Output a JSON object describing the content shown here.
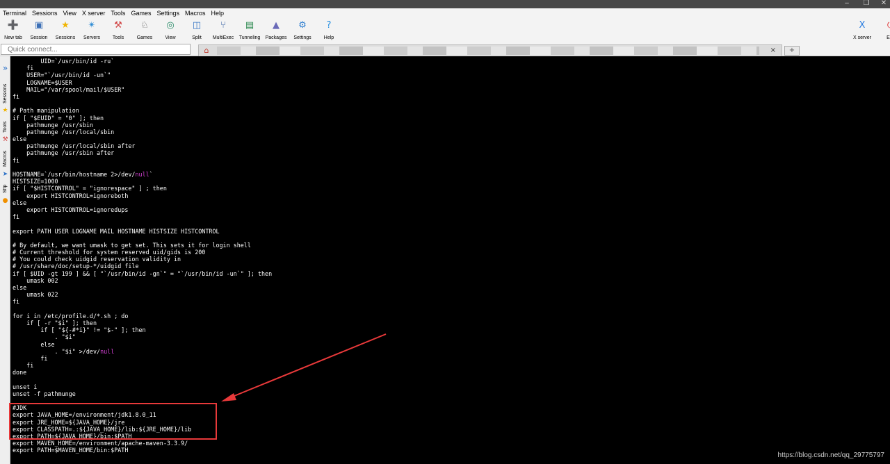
{
  "menu": [
    "Terminal",
    "Sessions",
    "View",
    "X server",
    "Tools",
    "Games",
    "Settings",
    "Macros",
    "Help"
  ],
  "toolbar": [
    {
      "label": "New tab",
      "icon": "new-tab-icon",
      "glyph": "➕",
      "color": "#2eab3a"
    },
    {
      "label": "Session",
      "icon": "session-icon",
      "glyph": "▣",
      "color": "#3b6fb6"
    },
    {
      "label": "Sessions",
      "icon": "sessions-star-icon",
      "glyph": "★",
      "color": "#f0b400"
    },
    {
      "label": "Servers",
      "icon": "servers-icon",
      "glyph": "✴",
      "color": "#2a8ad4"
    },
    {
      "label": "Tools",
      "icon": "tools-icon",
      "glyph": "⚒",
      "color": "#d04040"
    },
    {
      "label": "Games",
      "icon": "games-icon",
      "glyph": "♘",
      "color": "#555555"
    },
    {
      "label": "View",
      "icon": "view-icon",
      "glyph": "◎",
      "color": "#2c8c6a"
    },
    {
      "label": "Split",
      "icon": "split-icon",
      "glyph": "◫",
      "color": "#3574c4"
    },
    {
      "label": "MultiExec",
      "icon": "multiexec-icon",
      "glyph": "⑂",
      "color": "#2c5aa0"
    },
    {
      "label": "Tunneling",
      "icon": "tunneling-icon",
      "glyph": "▤",
      "color": "#2d8a50"
    },
    {
      "label": "Packages",
      "icon": "packages-icon",
      "glyph": "▲",
      "color": "#6a6ab8"
    },
    {
      "label": "Settings",
      "icon": "settings-gear-icon",
      "glyph": "⚙",
      "color": "#2f7fd0"
    },
    {
      "label": "Help",
      "icon": "help-icon",
      "glyph": "?",
      "color": "#1f8ce0"
    }
  ],
  "toolbar_right": [
    {
      "label": "X server",
      "icon": "x-server-icon",
      "glyph": "X",
      "color": "#2a7de0"
    },
    {
      "label": "Exit",
      "icon": "exit-power-icon",
      "glyph": "⏻",
      "color": "#e03030"
    }
  ],
  "quick_connect_placeholder": "Quick connect...",
  "sidebar": {
    "sessions": "Sessions",
    "tools": "Tools",
    "macros": "Macros",
    "sftp": "Sftp"
  },
  "terminal_lines": [
    "        UID=`/usr/bin/id -ru`",
    "    fi",
    "    USER=\"`/usr/bin/id -un`\"",
    "    LOGNAME=$USER",
    "    MAIL=\"/var/spool/mail/$USER\"",
    "fi",
    "",
    "# Path manipulation",
    "if [ \"$EUID\" = \"0\" ]; then",
    "    pathmunge /usr/sbin",
    "    pathmunge /usr/local/sbin",
    "else",
    "    pathmunge /usr/local/sbin after",
    "    pathmunge /usr/sbin after",
    "fi",
    "",
    "HOSTNAME=`/usr/bin/hostname 2>/dev/null`",
    "HISTSIZE=1000",
    "if [ \"$HISTCONTROL\" = \"ignorespace\" ] ; then",
    "    export HISTCONTROL=ignoreboth",
    "else",
    "    export HISTCONTROL=ignoredups",
    "fi",
    "",
    "export PATH USER LOGNAME MAIL HOSTNAME HISTSIZE HISTCONTROL",
    "",
    "# By default, we want umask to get set. This sets it for login shell",
    "# Current threshold for system reserved uid/gids is 200",
    "# You could check uidgid reservation validity in",
    "# /usr/share/doc/setup-*/uidgid file",
    "if [ $UID -gt 199 ] && [ \"`/usr/bin/id -gn`\" = \"`/usr/bin/id -un`\" ]; then",
    "    umask 002",
    "else",
    "    umask 022",
    "fi",
    "",
    "for i in /etc/profile.d/*.sh ; do",
    "    if [ -r \"$i\" ]; then",
    "        if [ \"${-#*i}\" != \"$-\" ]; then",
    "            . \"$i\"",
    "        else",
    "            . \"$i\" >/dev/null",
    "        fi",
    "    fi",
    "done",
    "",
    "unset i",
    "unset -f pathmunge",
    "",
    "#JDK",
    "export JAVA_HOME=/environment/jdk1.8.0_11",
    "export JRE_HOME=${JAVA_HOME}/jre",
    "export CLASSPATH=.:${JAVA_HOME}/lib:${JRE_HOME}/lib",
    "export PATH=${JAVA_HOME}/bin:$PATH",
    "export MAVEN_HOME=/environment/apache-maven-3.3.9/",
    "export PATH=$MAVEN_HOME/bin:$PATH"
  ],
  "watermark": "https://blog.csdn.net/qq_29775797",
  "colors": {
    "terminal_bg": "#000000",
    "terminal_fg": "#ffffff",
    "keyword": "#d340d3",
    "annotation": "#e8393a"
  }
}
